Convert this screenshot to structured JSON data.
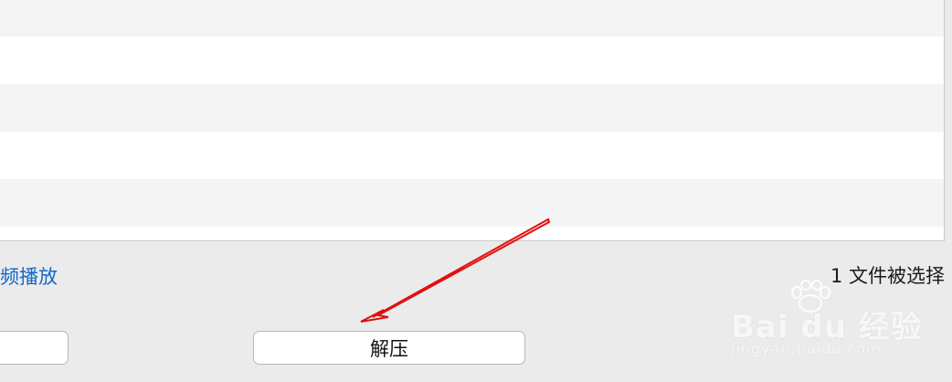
{
  "file_list": {
    "rows": 6
  },
  "footer": {
    "link_text": "频播放",
    "selection_status": "1 文件被选择",
    "left_button_label": "",
    "extract_button_label": "解压"
  },
  "annotation": {
    "arrow_color": "#e01010"
  },
  "watermark": {
    "brand": "Bai du 经验",
    "url": "jingyan.baidu.com"
  }
}
